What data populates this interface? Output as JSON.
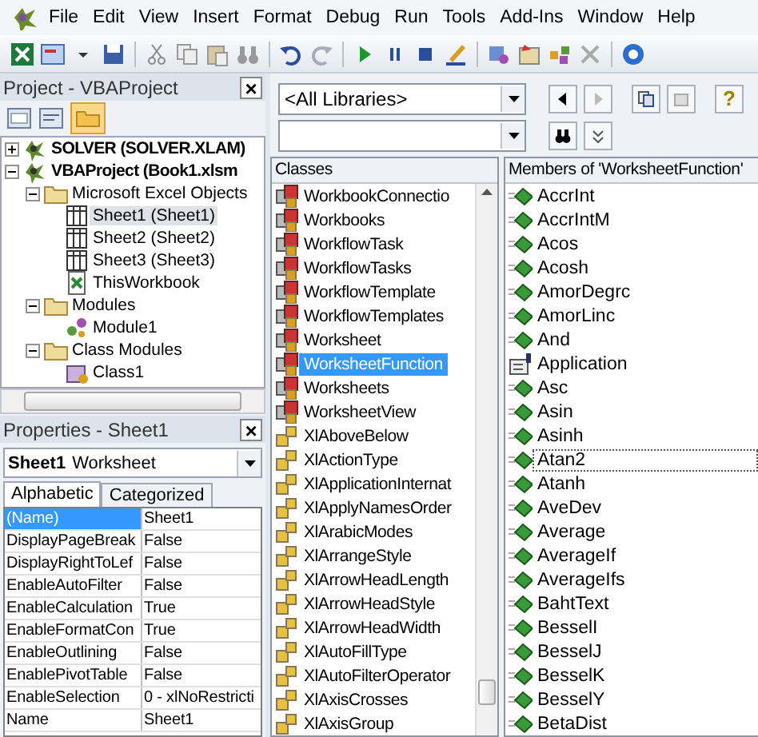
{
  "menu_bar": {
    "items": [
      "File",
      "Edit",
      "View",
      "Insert",
      "Format",
      "Debug",
      "Run",
      "Tools",
      "Add-Ins",
      "Window",
      "Help"
    ]
  },
  "project_pane": {
    "title": "Project - VBAProject",
    "close": "×",
    "tree": [
      {
        "label": "SOLVER (SOLVER.XLAM)",
        "kind": "project",
        "expanded": false,
        "selected": false
      },
      {
        "label": "VBAProject (Book1.xlsm",
        "kind": "project",
        "expanded": true,
        "selected": false,
        "children": [
          {
            "label": "Microsoft Excel Objects",
            "kind": "folder",
            "expanded": true,
            "selected": false,
            "children": [
              {
                "label": "Sheet1 (Sheet1)",
                "kind": "sheet",
                "selected": true
              },
              {
                "label": "Sheet2 (Sheet2)",
                "kind": "sheet",
                "selected": false
              },
              {
                "label": "Sheet3 (Sheet3)",
                "kind": "sheet",
                "selected": false
              },
              {
                "label": "ThisWorkbook",
                "kind": "workbook",
                "selected": false
              }
            ]
          },
          {
            "label": "Modules",
            "kind": "folder",
            "expanded": true,
            "selected": false,
            "children": [
              {
                "label": "Module1",
                "kind": "module",
                "selected": false
              }
            ]
          },
          {
            "label": "Class Modules",
            "kind": "folder",
            "expanded": true,
            "selected": false,
            "children": [
              {
                "label": "Class1",
                "kind": "class",
                "selected": false
              }
            ]
          }
        ]
      }
    ]
  },
  "properties_pane": {
    "title": "Properties - Sheet1",
    "close": "×",
    "object": {
      "name": "Sheet1",
      "type": "Worksheet"
    },
    "tabs": [
      {
        "label": "Alphabetic",
        "selected": true
      },
      {
        "label": "Categorized",
        "selected": false
      }
    ],
    "rows": [
      {
        "name": "(Name)",
        "value": "Sheet1",
        "selected": true
      },
      {
        "name": "DisplayPageBreak",
        "value": "False",
        "selected": false
      },
      {
        "name": "DisplayRightToLef",
        "value": "False",
        "selected": false
      },
      {
        "name": "EnableAutoFilter",
        "value": "False",
        "selected": false
      },
      {
        "name": "EnableCalculation",
        "value": "True",
        "selected": false
      },
      {
        "name": "EnableFormatCon",
        "value": "True",
        "selected": false
      },
      {
        "name": "EnableOutlining",
        "value": "False",
        "selected": false
      },
      {
        "name": "EnablePivotTable",
        "value": "False",
        "selected": false
      },
      {
        "name": "EnableSelection",
        "value": "0 - xlNoRestricti",
        "selected": false
      },
      {
        "name": "Name",
        "value": "Sheet1",
        "selected": false
      }
    ]
  },
  "object_browser": {
    "library": "<All Libraries>",
    "help_button": "?",
    "classes_header": "Classes",
    "classes": [
      {
        "label": "WorkbookConnectio",
        "kind": "class",
        "selected": false
      },
      {
        "label": "Workbooks",
        "kind": "class",
        "selected": false
      },
      {
        "label": "WorkflowTask",
        "kind": "class",
        "selected": false
      },
      {
        "label": "WorkflowTasks",
        "kind": "class",
        "selected": false
      },
      {
        "label": "WorkflowTemplate",
        "kind": "class",
        "selected": false
      },
      {
        "label": "WorkflowTemplates",
        "kind": "class",
        "selected": false
      },
      {
        "label": "Worksheet",
        "kind": "class",
        "selected": false
      },
      {
        "label": "WorksheetFunction",
        "kind": "class",
        "selected": true
      },
      {
        "label": "Worksheets",
        "kind": "class",
        "selected": false
      },
      {
        "label": "WorksheetView",
        "kind": "class",
        "selected": false
      },
      {
        "label": "XlAboveBelow",
        "kind": "enum",
        "selected": false
      },
      {
        "label": "XlActionType",
        "kind": "enum",
        "selected": false
      },
      {
        "label": "XlApplicationInternat",
        "kind": "enum",
        "selected": false
      },
      {
        "label": "XlApplyNamesOrder",
        "kind": "enum",
        "selected": false
      },
      {
        "label": "XlArabicModes",
        "kind": "enum",
        "selected": false
      },
      {
        "label": "XlArrangeStyle",
        "kind": "enum",
        "selected": false
      },
      {
        "label": "XlArrowHeadLength",
        "kind": "enum",
        "selected": false
      },
      {
        "label": "XlArrowHeadStyle",
        "kind": "enum",
        "selected": false
      },
      {
        "label": "XlArrowHeadWidth",
        "kind": "enum",
        "selected": false
      },
      {
        "label": "XlAutoFillType",
        "kind": "enum",
        "selected": false
      },
      {
        "label": "XlAutoFilterOperator",
        "kind": "enum",
        "selected": false
      },
      {
        "label": "XlAxisCrosses",
        "kind": "enum",
        "selected": false
      },
      {
        "label": "XlAxisGroup",
        "kind": "enum",
        "selected": false
      }
    ],
    "members_header": "Members of 'WorksheetFunction'",
    "members": [
      {
        "label": "AccrInt",
        "kind": "method",
        "focused": false
      },
      {
        "label": "AccrIntM",
        "kind": "method",
        "focused": false
      },
      {
        "label": "Acos",
        "kind": "method",
        "focused": false
      },
      {
        "label": "Acosh",
        "kind": "method",
        "focused": false
      },
      {
        "label": "AmorDegrc",
        "kind": "method",
        "focused": false
      },
      {
        "label": "AmorLinc",
        "kind": "method",
        "focused": false
      },
      {
        "label": "And",
        "kind": "method",
        "focused": false
      },
      {
        "label": "Application",
        "kind": "property",
        "focused": false
      },
      {
        "label": "Asc",
        "kind": "method",
        "focused": false
      },
      {
        "label": "Asin",
        "kind": "method",
        "focused": false
      },
      {
        "label": "Asinh",
        "kind": "method",
        "focused": false
      },
      {
        "label": "Atan2",
        "kind": "method",
        "focused": true
      },
      {
        "label": "Atanh",
        "kind": "method",
        "focused": false
      },
      {
        "label": "AveDev",
        "kind": "method",
        "focused": false
      },
      {
        "label": "Average",
        "kind": "method",
        "focused": false
      },
      {
        "label": "AverageIf",
        "kind": "method",
        "focused": false
      },
      {
        "label": "AverageIfs",
        "kind": "method",
        "focused": false
      },
      {
        "label": "BahtText",
        "kind": "method",
        "focused": false
      },
      {
        "label": "BesselI",
        "kind": "method",
        "focused": false
      },
      {
        "label": "BesselJ",
        "kind": "method",
        "focused": false
      },
      {
        "label": "BesselK",
        "kind": "method",
        "focused": false
      },
      {
        "label": "BesselY",
        "kind": "method",
        "focused": false
      },
      {
        "label": "BetaDist",
        "kind": "method",
        "focused": false
      }
    ]
  }
}
